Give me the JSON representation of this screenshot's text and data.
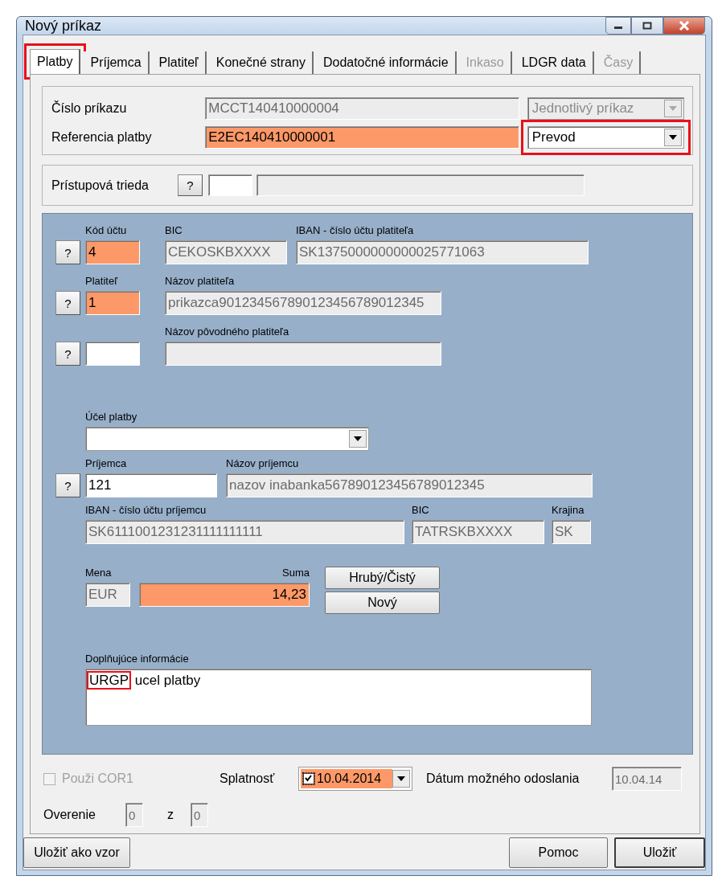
{
  "window": {
    "title": "Nový príkaz"
  },
  "tabs": [
    {
      "label": "Platby",
      "selected": true,
      "disabled": false,
      "highlighted": true
    },
    {
      "label": "Príjemca",
      "selected": false,
      "disabled": false,
      "highlighted": false
    },
    {
      "label": "Platiteľ",
      "selected": false,
      "disabled": false,
      "highlighted": false
    },
    {
      "label": "Konečné strany",
      "selected": false,
      "disabled": false,
      "highlighted": false
    },
    {
      "label": "Dodatočné informácie",
      "selected": false,
      "disabled": false,
      "highlighted": false
    },
    {
      "label": "Inkaso",
      "selected": false,
      "disabled": true,
      "highlighted": false
    },
    {
      "label": "LDGR data",
      "selected": false,
      "disabled": false,
      "highlighted": false
    },
    {
      "label": "Časy",
      "selected": false,
      "disabled": true,
      "highlighted": false
    }
  ],
  "header": [
    {
      "label": "Číslo príkazu",
      "value": "MCCT140410000004",
      "required": false,
      "readonly": true,
      "type_select": {
        "value": "Jednotlivý príkaz",
        "disabled": true,
        "highlighted": false
      }
    },
    {
      "label": "Referencia platby",
      "value": "E2EC140410000001",
      "required": true,
      "readonly": false,
      "type_select": {
        "value": "Prevod",
        "disabled": false,
        "highlighted": true
      }
    }
  ],
  "access_class": {
    "label": "Prístupová trieda",
    "help": "?",
    "fields": [
      {
        "required": false,
        "readonly": false
      },
      {
        "required": false,
        "readonly": true
      }
    ]
  },
  "payer_rows": [
    {
      "help": "?",
      "fields": [
        {
          "label": "Kód účtu",
          "value": "4",
          "required": true,
          "readonly": false
        },
        {
          "label": "BIC",
          "value": "CEKOSKBXXXX",
          "required": false,
          "readonly": true
        },
        {
          "label": "IBAN - číslo účtu platiteľa",
          "value": "SK1375000000000025771063",
          "required": false,
          "readonly": true
        }
      ]
    },
    {
      "help": "?",
      "fields": [
        {
          "label": "Platiteľ",
          "value": "1",
          "required": true,
          "readonly": false
        },
        {
          "label": "Názov platiteľa",
          "value": "prikazca901234567890123456789012345",
          "required": false,
          "readonly": true
        }
      ]
    },
    {
      "help": "?",
      "fields": [
        {
          "required": false,
          "readonly": false
        },
        {
          "label": "Názov pôvodného platiteľa",
          "required": false,
          "readonly": true
        }
      ]
    }
  ],
  "purpose": {
    "label": "Účel platby",
    "disabled": false
  },
  "recipient_rows": [
    {
      "help": "?",
      "fields": [
        {
          "label": "Príjemca",
          "value": "121",
          "required": false,
          "readonly": false
        },
        {
          "label": "Názov príjemcu",
          "value": "nazov inabanka567890123456789012345",
          "required": false,
          "readonly": true
        }
      ]
    },
    {
      "fields": [
        {
          "label": "IBAN - číslo účtu príjemcu",
          "value": "SK6111001231231111111111",
          "required": false,
          "readonly": true
        },
        {
          "label": "BIC",
          "value": "TATRSKBXXXX",
          "required": false,
          "readonly": true
        },
        {
          "label": "Krajina",
          "value": "SK",
          "required": false,
          "readonly": true
        }
      ]
    }
  ],
  "amount": {
    "currency": {
      "label": "Mena",
      "value": "EUR",
      "required": false,
      "readonly": true
    },
    "sum": {
      "label": "Suma",
      "value": "14,23",
      "required": true,
      "readonly": false
    },
    "buttons": [
      "Hrubý/Čistý",
      "Nový"
    ]
  },
  "note": {
    "label": "Doplňujúce informácie",
    "parts": [
      {
        "text": "URGP",
        "highlighted": true
      },
      {
        "text": "ucel platby",
        "highlighted": false
      }
    ]
  },
  "cor1": {
    "label": "Použi COR1",
    "checked": false,
    "disabled": true
  },
  "due_date": {
    "label": "Splatnosť",
    "value": "10.04.2014",
    "checked": true,
    "required": true
  },
  "send_date": {
    "label": "Dátum možného odoslania",
    "value": "10.04.14",
    "required": false,
    "readonly": true
  },
  "verification": {
    "label": "Overenie",
    "separator": "z",
    "fields": [
      {
        "value": "0",
        "required": false,
        "readonly": true
      },
      {
        "value": "0",
        "required": false,
        "readonly": true
      }
    ]
  },
  "footer_buttons": [
    "Uložiť ako vzor",
    "Pomoc",
    "Uložiť"
  ]
}
